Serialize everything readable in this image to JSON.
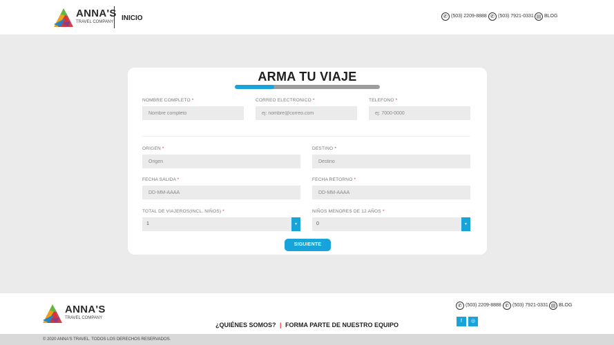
{
  "header": {
    "logo_name": "ANNA'S",
    "logo_sub": "TRAVEL COMPANY",
    "nav": "INICIO",
    "phone1": "(503) 2209-8888",
    "phone2": "(503) 7921-0331",
    "blog": "BLOG"
  },
  "form": {
    "title": "ARMA TU VIAJE",
    "progress_percent": 27,
    "nombre_label": "NOMBRE COMPLETO",
    "nombre_placeholder": "Nombre completo",
    "correo_label": "CORREO ELECTRONICO",
    "correo_placeholder": "ej: nombre@correo.com",
    "telefono_label": "TELEFONO",
    "telefono_placeholder": "ej: 7000-0000",
    "origen_label": "ORIGEN",
    "origen_placeholder": "Origen",
    "destino_label": "DESTINO",
    "destino_placeholder": "Destino",
    "salida_label": "FECHA SALIDA",
    "salida_placeholder": "DD-MM-AAAA",
    "retorno_label": "FECHA RETORNO",
    "retorno_placeholder": "DD-MM-AAAA",
    "viajeros_label": "TOTAL DE VIAJEROS(INCL. NIÑOS)",
    "viajeros_value": "1",
    "ninos_label": "NIÑOS MENORES DE 12 AÑOS",
    "ninos_value": "0",
    "required_mark": "*",
    "submit": "SIGUIENTE"
  },
  "footer": {
    "logo_name": "ANNA'S",
    "logo_sub": "TRAVEL COMPANY",
    "phone1": "(503) 2209-8888",
    "phone2": "(503) 7921-0331",
    "blog": "BLOG",
    "link1": "¿QUIÉNES SOMOS?",
    "separator": "|",
    "link2": "FORMA PARTE DE NUESTRO EQUIPO",
    "copyright": "© 2020 ANNA'S TRAVEL. TODOS LOS DERECHOS RESERVADOS."
  },
  "icons": {
    "phone": "phone-icon",
    "whatsapp": "whatsapp-icon",
    "blog": "blog-icon",
    "facebook": "facebook-icon",
    "instagram": "instagram-icon"
  },
  "colors": {
    "accent": "#18a3db",
    "required": "#e0313a",
    "background": "#ebebeb"
  }
}
